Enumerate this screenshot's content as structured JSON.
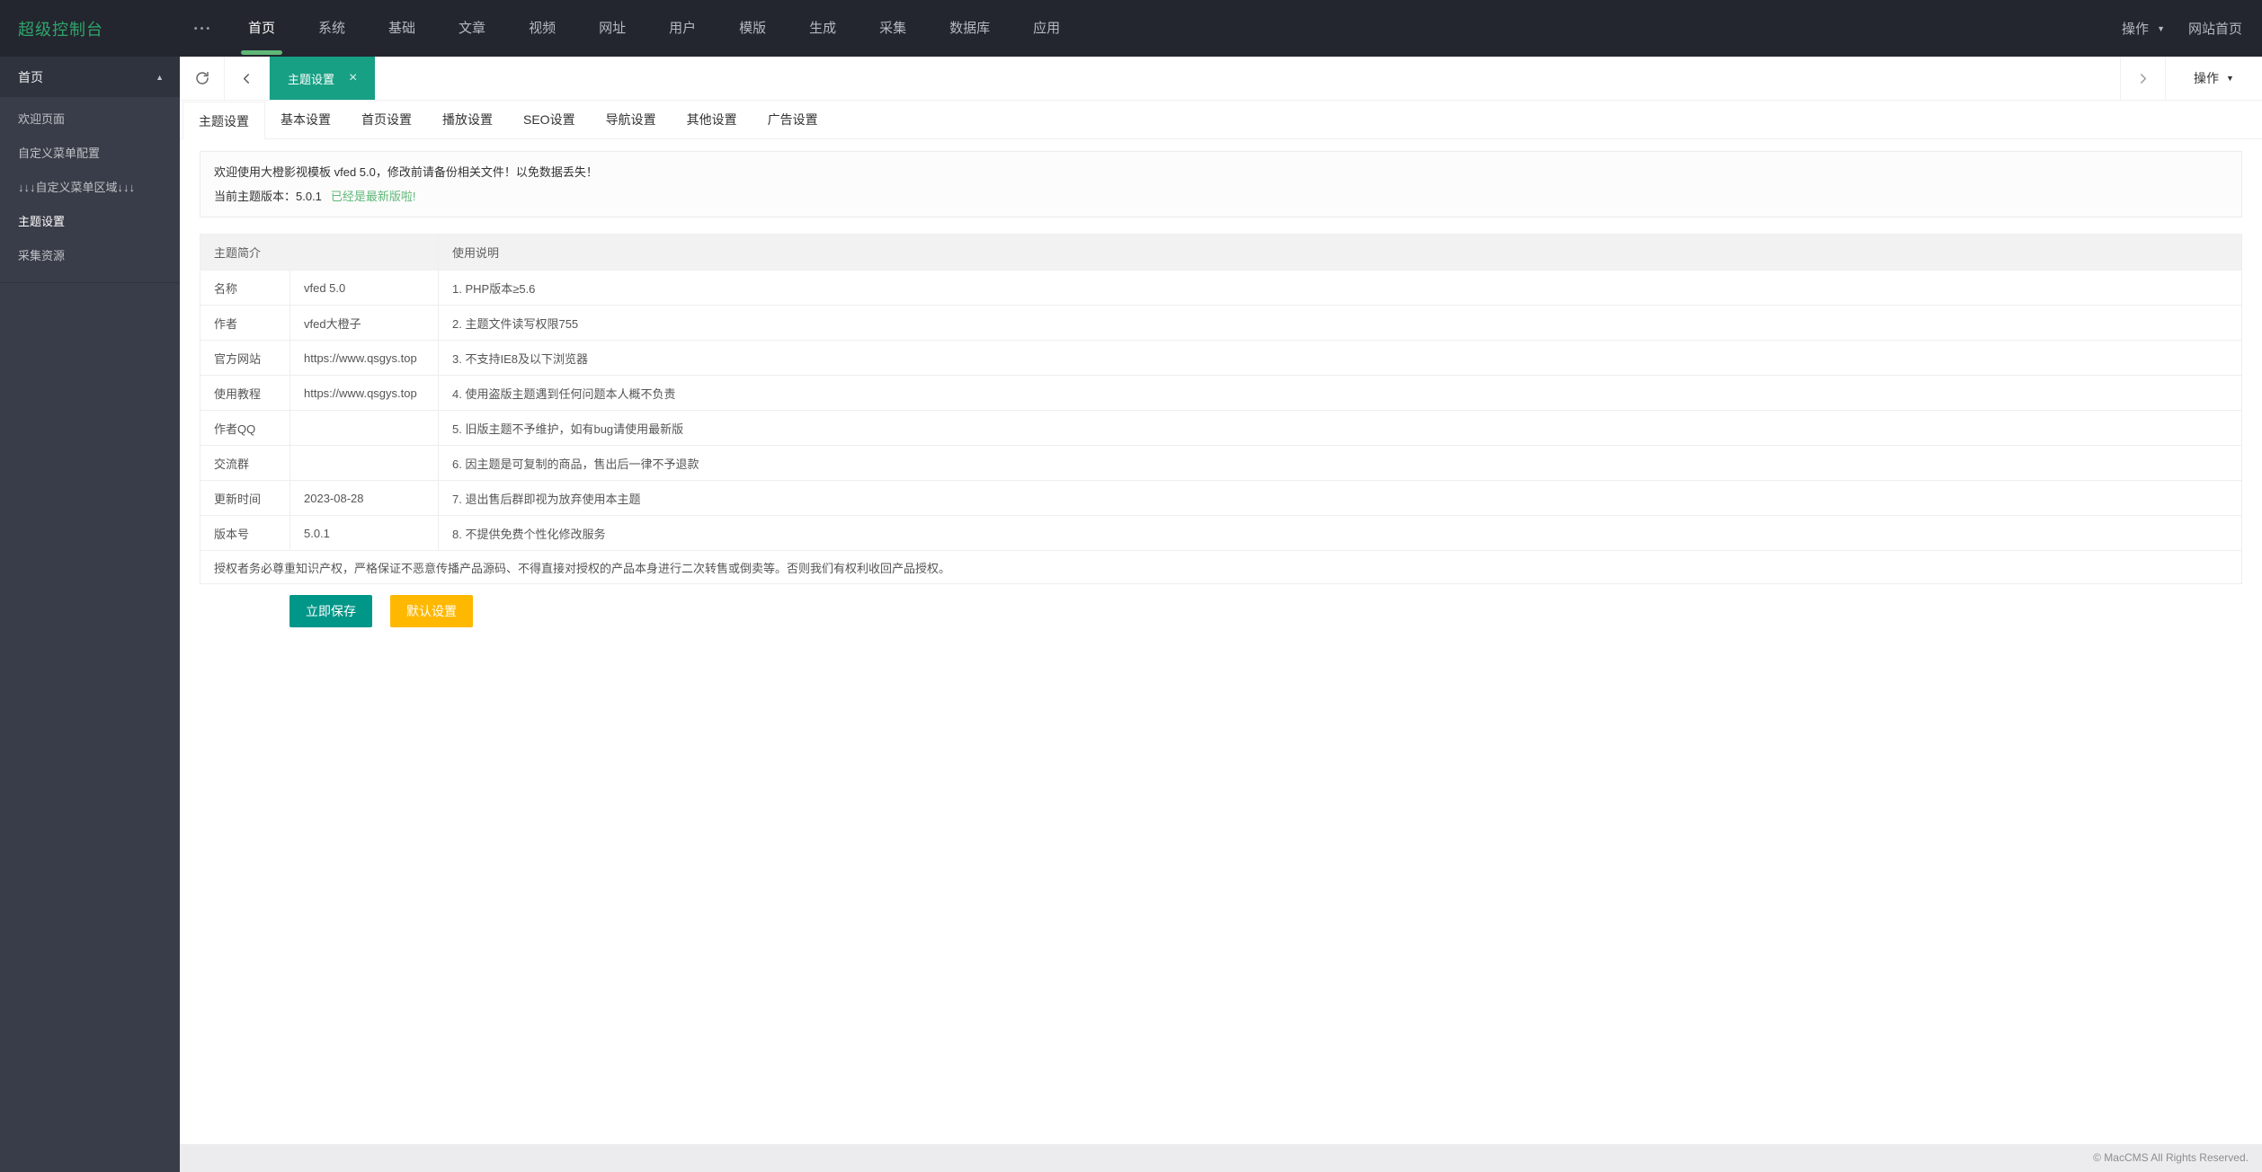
{
  "topbar": {
    "logo": "超级控制台",
    "more_icon": "•••",
    "menus": [
      "首页",
      "系统",
      "基础",
      "文章",
      "视频",
      "网址",
      "用户",
      "模版",
      "生成",
      "采集",
      "数据库",
      "应用"
    ],
    "active_menu": "首页",
    "right": {
      "action_label": "操作",
      "site_home": "网站首页"
    }
  },
  "sidebar": {
    "group_label": "首页",
    "items": [
      {
        "label": "欢迎页面",
        "active": false
      },
      {
        "label": "自定义菜单配置",
        "active": false
      },
      {
        "label": "↓↓↓自定义菜单区域↓↓↓",
        "active": false
      },
      {
        "label": "主题设置",
        "active": true
      },
      {
        "label": "采集资源",
        "active": false
      }
    ]
  },
  "tabbar": {
    "active_tab": "主题设置",
    "action_label": "操作"
  },
  "content": {
    "tabs": [
      "主题设置",
      "基本设置",
      "首页设置",
      "播放设置",
      "SEO设置",
      "导航设置",
      "其他设置",
      "广告设置"
    ],
    "active_tab": "主题设置",
    "notice": {
      "line1": "欢迎使用大橙影视模板 vfed 5.0，修改前请备份相关文件！以免数据丢失！",
      "line2_prefix": "当前主题版本：5.0.1",
      "line2_highlight": "已经是最新版啦!"
    },
    "table": {
      "headers": [
        "主题简介",
        "使用说明"
      ],
      "rows": [
        {
          "label": "名称",
          "value": "vfed 5.0",
          "note": "1. PHP版本≥5.6"
        },
        {
          "label": "作者",
          "value": "vfed大橙子",
          "note": "2. 主题文件读写权限755"
        },
        {
          "label": "官方网站",
          "value": "https://www.qsgys.top",
          "note": "3. 不支持IE8及以下浏览器"
        },
        {
          "label": "使用教程",
          "value": "https://www.qsgys.top",
          "note": "4. 使用盗版主题遇到任何问题本人概不负责"
        },
        {
          "label": "作者QQ",
          "value": "",
          "note": "5. 旧版主题不予维护，如有bug请使用最新版"
        },
        {
          "label": "交流群",
          "value": "",
          "note": "6. 因主题是可复制的商品，售出后一律不予退款"
        },
        {
          "label": "更新时间",
          "value": "2023-08-28",
          "note": "7. 退出售后群即视为放弃使用本主题"
        },
        {
          "label": "版本号",
          "value": "5.0.1",
          "note": "8. 不提供免费个性化修改服务"
        }
      ],
      "footer": "授权者务必尊重知识产权，严格保证不恶意传播产品源码、不得直接对授权的产品本身进行二次转售或倒卖等。否则我们有权利收回产品授权。"
    },
    "buttons": {
      "save": "立即保存",
      "default": "默认设置"
    }
  },
  "footer": {
    "copyright": "© MacCMS All Rights Reserved."
  },
  "colors": {
    "topbar_bg": "#23262E",
    "sidebar_bg": "#393D49",
    "logo_green": "#2FA56B",
    "nav_underline": "#5FB878",
    "active_tab_teal": "#17A084",
    "save_button": "#009688",
    "default_button": "#FFB800",
    "notice_highlight": "#5FB878"
  }
}
